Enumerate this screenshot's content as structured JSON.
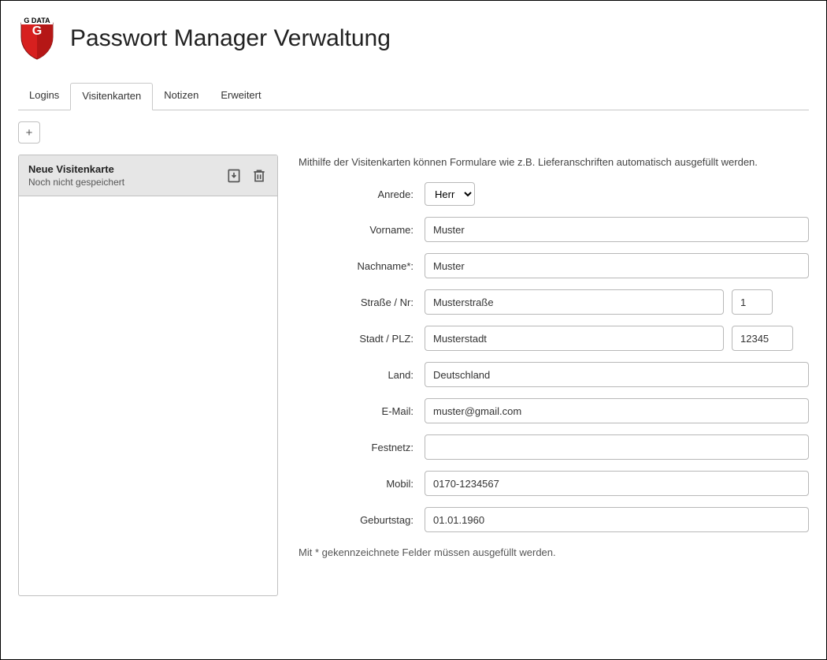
{
  "header": {
    "title": "Passwort Manager Verwaltung"
  },
  "tabs": [
    {
      "label": "Logins"
    },
    {
      "label": "Visitenkarten"
    },
    {
      "label": "Notizen"
    },
    {
      "label": "Erweitert"
    }
  ],
  "active_tab_index": 1,
  "add_button": "+",
  "sidebar": {
    "item": {
      "title": "Neue Visitenkarte",
      "subtitle": "Noch nicht gespeichert"
    }
  },
  "main": {
    "help_text": "Mithilfe der Visitenkarten können Formulare wie z.B. Lieferanschriften automatisch ausgefüllt werden.",
    "labels": {
      "anrede": "Anrede:",
      "vorname": "Vorname:",
      "nachname": "Nachname*:",
      "strasse": "Straße / Nr:",
      "stadt": "Stadt / PLZ:",
      "land": "Land:",
      "email": "E-Mail:",
      "festnetz": "Festnetz:",
      "mobil": "Mobil:",
      "geburtstag": "Geburtstag:"
    },
    "values": {
      "anrede": "Herr",
      "vorname": "Muster",
      "nachname": "Muster",
      "strasse": "Musterstraße",
      "hausnr": "1",
      "stadt": "Musterstadt",
      "plz": "12345",
      "land": "Deutschland",
      "email": "muster@gmail.com",
      "festnetz": "",
      "mobil": "0170-1234567",
      "geburtstag": "01.01.1960"
    },
    "footnote": "Mit * gekennzeichnete Felder müssen ausgefüllt werden."
  }
}
